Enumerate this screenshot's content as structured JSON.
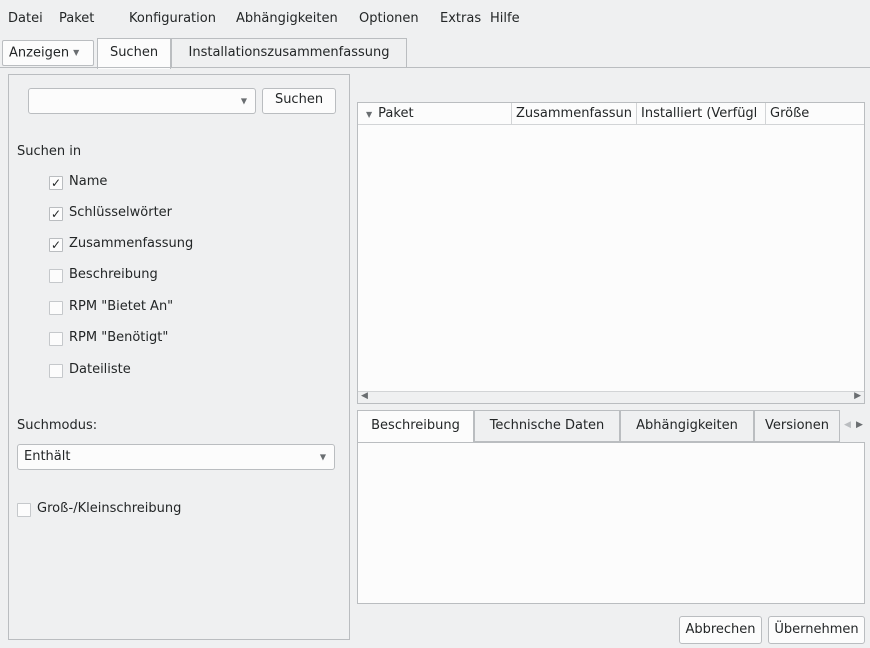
{
  "menubar": {
    "items": [
      "Datei",
      "Paket",
      "Konfiguration",
      "Abhängigkeiten",
      "Optionen",
      "Extras",
      "Hilfe"
    ]
  },
  "toptabs": {
    "view_button": "Anzeigen",
    "tabs": [
      "Suchen",
      "Installationszusammenfassung"
    ],
    "active": "Suchen"
  },
  "search": {
    "input_value": "",
    "button_label": "Suchen",
    "search_in_label": "Suchen in",
    "options": [
      {
        "label": "Name",
        "checked": true
      },
      {
        "label": "Schlüsselwörter",
        "checked": true
      },
      {
        "label": "Zusammenfassung",
        "checked": true
      },
      {
        "label": "Beschreibung",
        "checked": false
      },
      {
        "label": "RPM \"Bietet An\"",
        "checked": false
      },
      {
        "label": "RPM \"Benötigt\"",
        "checked": false
      },
      {
        "label": "Dateiliste",
        "checked": false
      }
    ],
    "mode_label": "Suchmodus:",
    "mode_value": "Enthält",
    "case_label": "Groß-/Kleinschreibung",
    "case_checked": false
  },
  "table": {
    "columns": [
      "Paket",
      "Zusammenfassun",
      "Installiert (Verfügl",
      "Größe"
    ]
  },
  "detail_tabs": [
    "Beschreibung",
    "Technische Daten",
    "Abhängigkeiten",
    "Versionen"
  ],
  "footer": {
    "cancel_label": "Abbrechen",
    "apply_label": "Übernehmen"
  }
}
